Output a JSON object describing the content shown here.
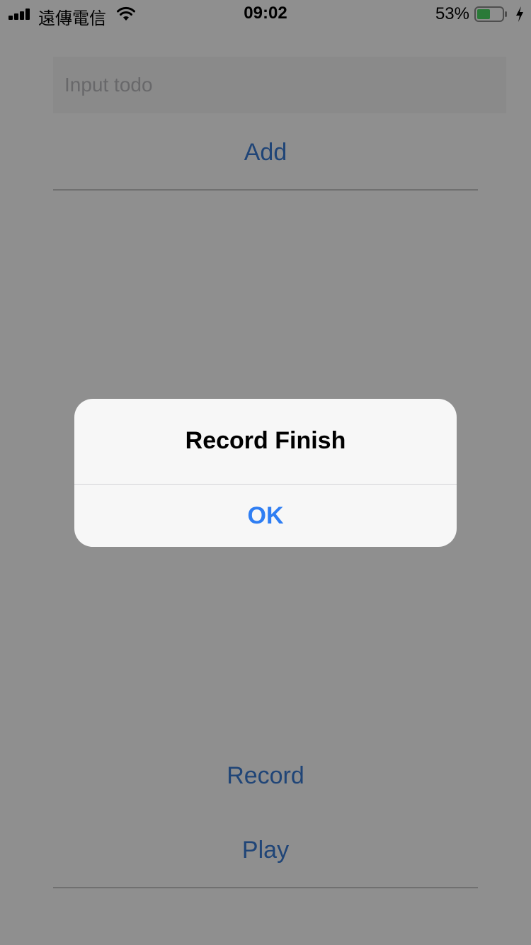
{
  "status_bar": {
    "carrier": "遠傳電信",
    "time": "09:02",
    "battery_percent": "53%",
    "battery_level": 0.53,
    "charging": true,
    "battery_color": "#4cd964"
  },
  "todo": {
    "input_placeholder": "Input todo",
    "input_value": "",
    "add_label": "Add"
  },
  "audio": {
    "record_label": "Record",
    "play_label": "Play"
  },
  "alert": {
    "title": "Record Finish",
    "ok_label": "OK"
  },
  "colors": {
    "accent": "#3a7bd5",
    "alert_button": "#2f7ef3",
    "alert_background": "#f7f7f7",
    "overlay": "rgba(0,0,0,0.44)"
  }
}
